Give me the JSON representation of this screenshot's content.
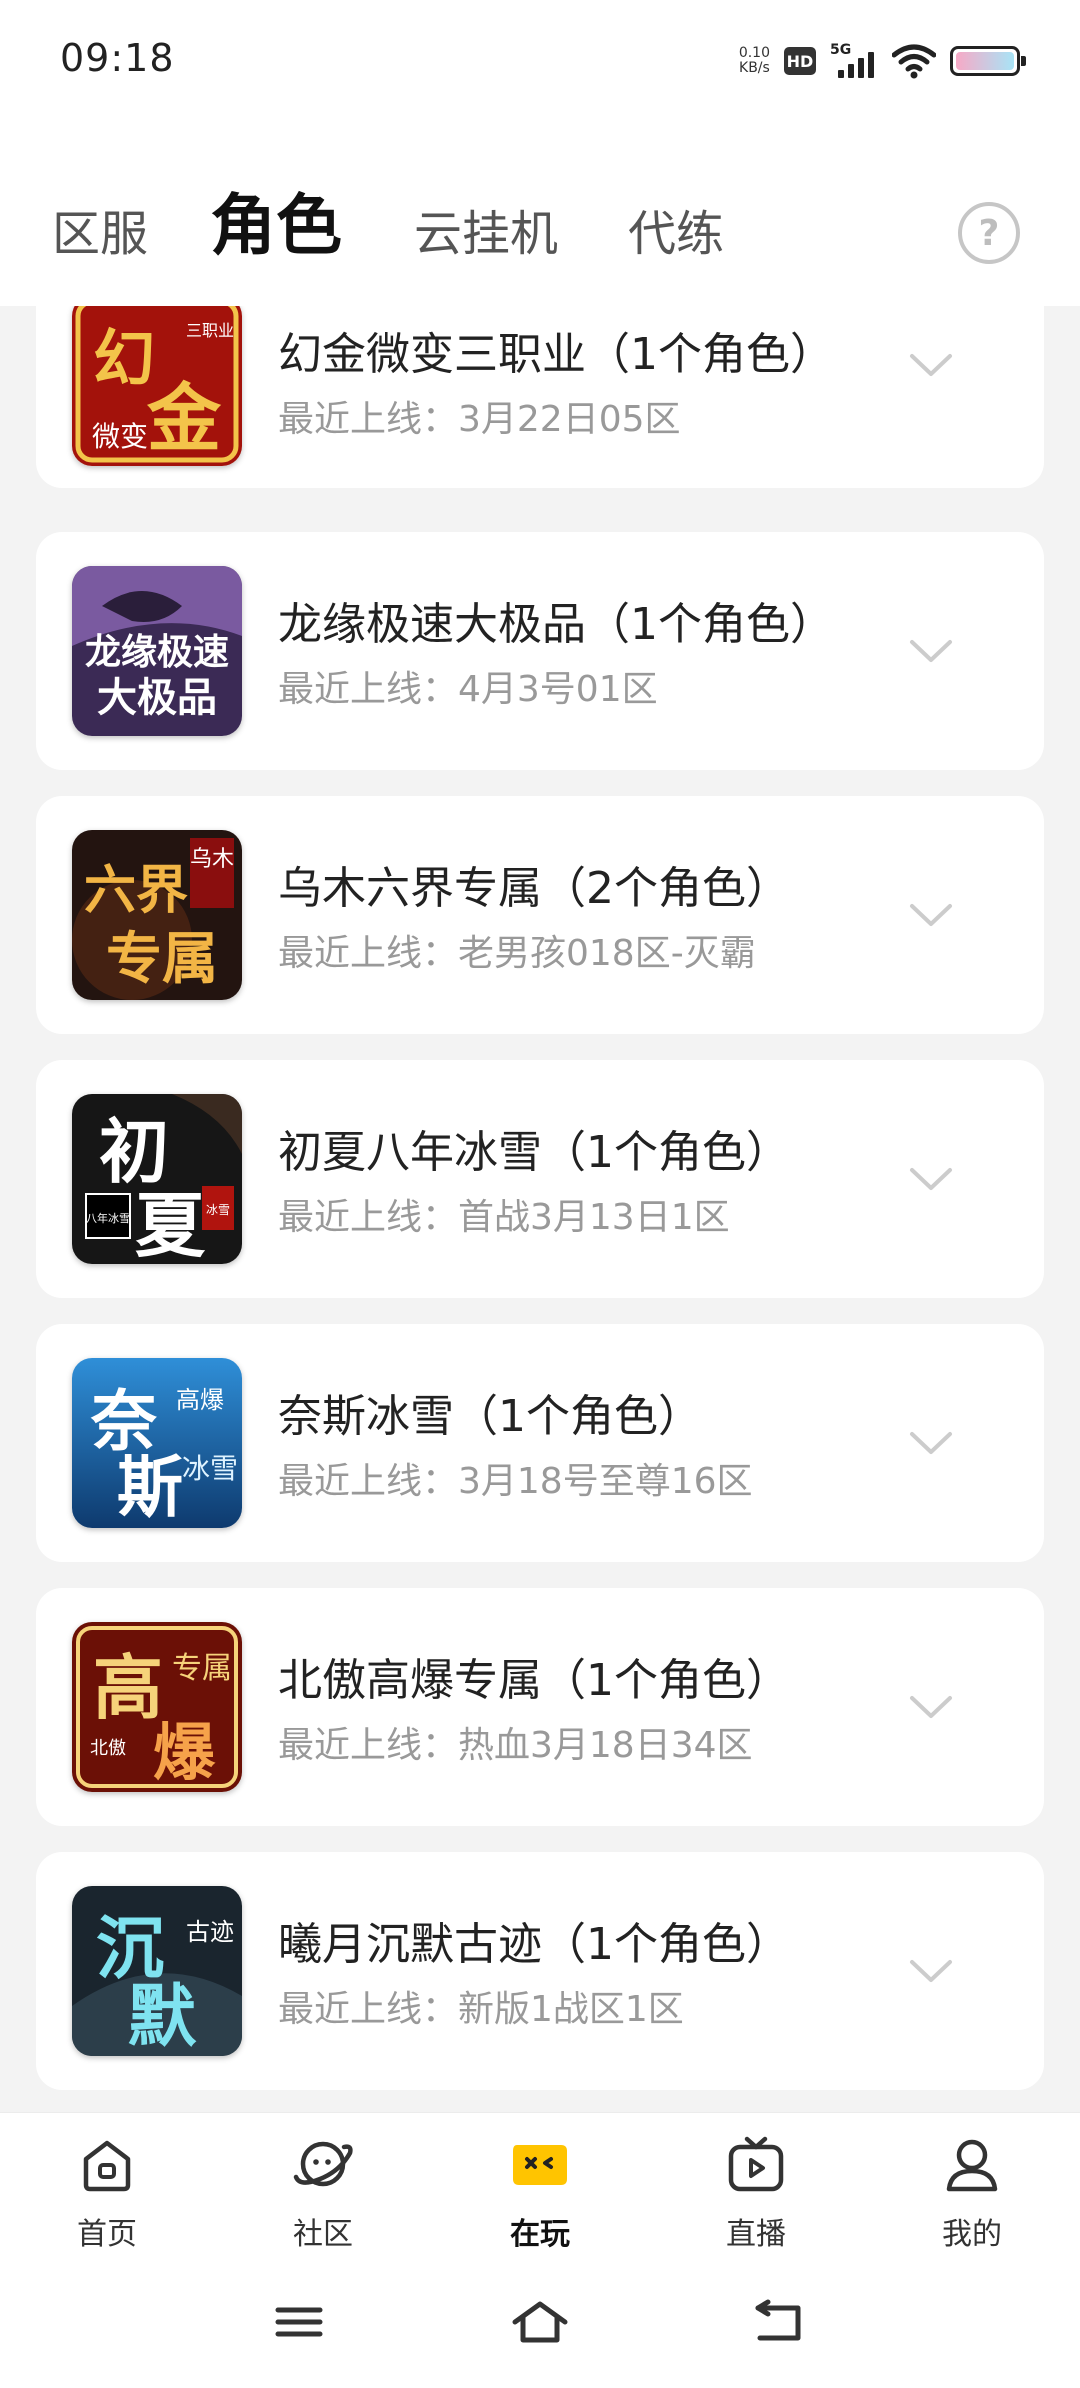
{
  "status_bar": {
    "time": "09:18",
    "net_speed_value": "0.10",
    "net_speed_unit": "KB/s",
    "hd_label": "HD",
    "network_label": "5G",
    "icons": [
      "hd-icon",
      "signal-5g-icon",
      "wifi-icon",
      "battery-icon"
    ]
  },
  "tabs": [
    {
      "label": "区服",
      "active": false
    },
    {
      "label": "角色",
      "active": true
    },
    {
      "label": "云挂机",
      "active": false
    },
    {
      "label": "代练",
      "active": false
    }
  ],
  "help": {
    "label": "?"
  },
  "games": [
    {
      "title": "幻金微变三职业（1个角色）",
      "last_online": "最近上线：3月22日05区",
      "icon_text": [
        "幻",
        "金"
      ],
      "icon_small": [
        "三职业",
        "微变"
      ],
      "icon_colors": [
        "#b5160e",
        "#f3c44a"
      ]
    },
    {
      "title": "龙缘极速大极品（1个角色）",
      "last_online": "最近上线：4月3号01区",
      "icon_text": [
        "龙缘极速",
        "大极品"
      ],
      "icon_small": [],
      "icon_colors": [
        "#5a3a7a",
        "#ffffff"
      ]
    },
    {
      "title": "乌木六界专属（2个角色）",
      "last_online": "最近上线：老男孩018区-灭霸",
      "icon_text": [
        "六界",
        "专属"
      ],
      "icon_small": [
        "乌木"
      ],
      "icon_colors": [
        "#2a1a12",
        "#f2b545"
      ]
    },
    {
      "title": "初夏八年冰雪（1个角色）",
      "last_online": "最近上线：首战3月13日1区",
      "icon_text": [
        "初",
        "夏"
      ],
      "icon_small": [
        "八年冰雪",
        "冰雪"
      ],
      "icon_colors": [
        "#1c1c1c",
        "#ffffff"
      ]
    },
    {
      "title": "奈斯冰雪（1个角色）",
      "last_online": "最近上线：3月18号至尊16区",
      "icon_text": [
        "奈",
        "斯"
      ],
      "icon_small": [
        "高爆",
        "冰雪"
      ],
      "icon_colors": [
        "#1a5f9e",
        "#ffffff"
      ]
    },
    {
      "title": "北傲高爆专属（1个角色）",
      "last_online": "最近上线：热血3月18日34区",
      "icon_text": [
        "高",
        "爆"
      ],
      "icon_small": [
        "专属",
        "北傲"
      ],
      "icon_colors": [
        "#7a1208",
        "#f6d37a"
      ]
    },
    {
      "title": "曦月沉默古迹（1个角色）",
      "last_online": "最近上线：新版1战区1区",
      "icon_text": [
        "沉",
        "默"
      ],
      "icon_small": [
        "古迹"
      ],
      "icon_colors": [
        "#1e2a33",
        "#7fe3f0"
      ]
    }
  ],
  "bottom_nav": [
    {
      "label": "首页",
      "icon": "home-icon",
      "active": false
    },
    {
      "label": "社区",
      "icon": "community-planet-icon",
      "active": false
    },
    {
      "label": "在玩",
      "icon": "gamepad-icon",
      "active": true
    },
    {
      "label": "直播",
      "icon": "tv-live-icon",
      "active": false
    },
    {
      "label": "我的",
      "icon": "profile-icon",
      "active": false
    }
  ],
  "system_nav": [
    "menu-icon",
    "home-outline-icon",
    "back-icon"
  ],
  "colors": {
    "accent": "#ffc400",
    "background": "#f3f3f3",
    "card": "#ffffff",
    "title_text": "#222222",
    "secondary_text": "#999999"
  }
}
